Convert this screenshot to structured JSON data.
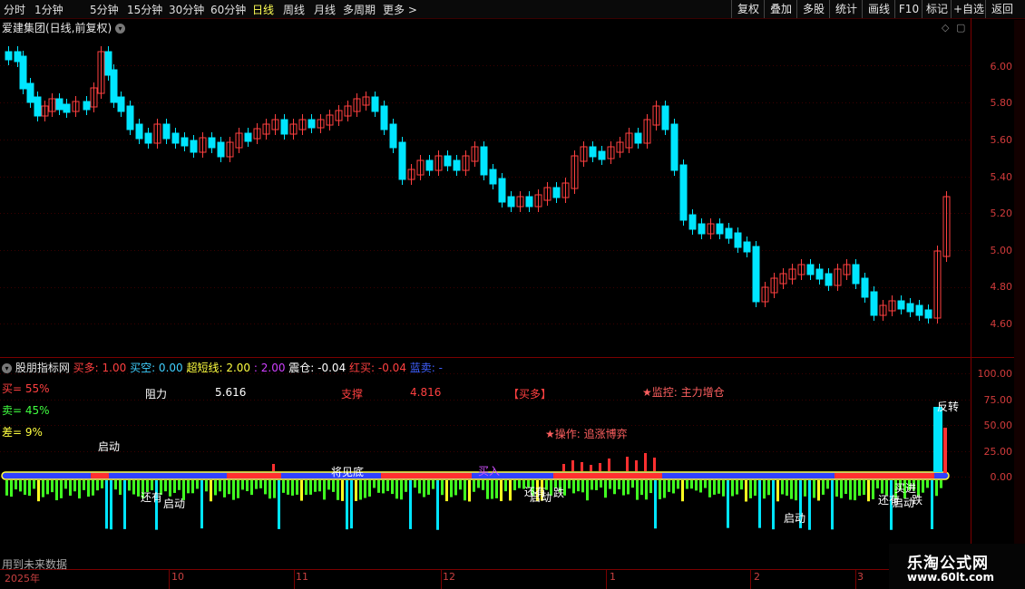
{
  "toolbar": {
    "periods": [
      "分时",
      "1分钟",
      "5分钟",
      "15分钟",
      "30分钟",
      "60分钟",
      "日线",
      "周线",
      "月线",
      "多周期",
      "更多 >"
    ],
    "active_period": "日线",
    "right_buttons": [
      "复权",
      "叠加",
      "多股",
      "统计",
      "画线",
      "F10",
      "标记",
      "+自选",
      "返回"
    ]
  },
  "main_chart": {
    "title": "爱建集团(日线,前复权)",
    "y_ticks": [
      "6.00",
      "5.80",
      "5.60",
      "5.40",
      "5.20",
      "5.00",
      "4.80",
      "4.60"
    ]
  },
  "indicator": {
    "name": "股朋指标网",
    "params": [
      {
        "label": "买多: 1.00",
        "color": "#ff4040"
      },
      {
        "label": "买空: 0.00",
        "color": "#40d0ff"
      },
      {
        "label": "超短线: 2.00",
        "color": "#ffff40"
      },
      {
        "label": ": 2.00",
        "color": "#d040ff"
      },
      {
        "label": "震仓: -0.04",
        "color": "#ffffff"
      },
      {
        "label": "红买: -0.04",
        "color": "#ff4040"
      },
      {
        "label": "蓝卖: -",
        "color": "#4060ff"
      }
    ],
    "buy_pct": "买= 55%",
    "sell_pct": "卖= 45%",
    "diff_pct": "差= 9%",
    "resistance_label": "阻力",
    "resistance_value": "5.616",
    "support_label": "支撑",
    "support_value": "4.816",
    "signal_tag": "【买多】",
    "monitor": "★监控: 主力增仓",
    "operation": "★操作: 追涨博弈",
    "y_ticks": [
      "100.00",
      "75.00",
      "50.00",
      "25.00",
      "0.00"
    ],
    "annotations": [
      "启动",
      "还有",
      "启动",
      "将见底",
      "买入",
      "还有",
      "启动",
      "跌",
      "反转",
      "启动",
      "还有",
      "启动",
      "跌",
      "买进"
    ],
    "footer_note": "用到未来数据"
  },
  "dates": [
    "2025年",
    "10",
    "11",
    "12",
    "1",
    "2",
    "3"
  ],
  "logo": {
    "name": "乐淘公式网",
    "url": "www.60lt.com"
  }
}
